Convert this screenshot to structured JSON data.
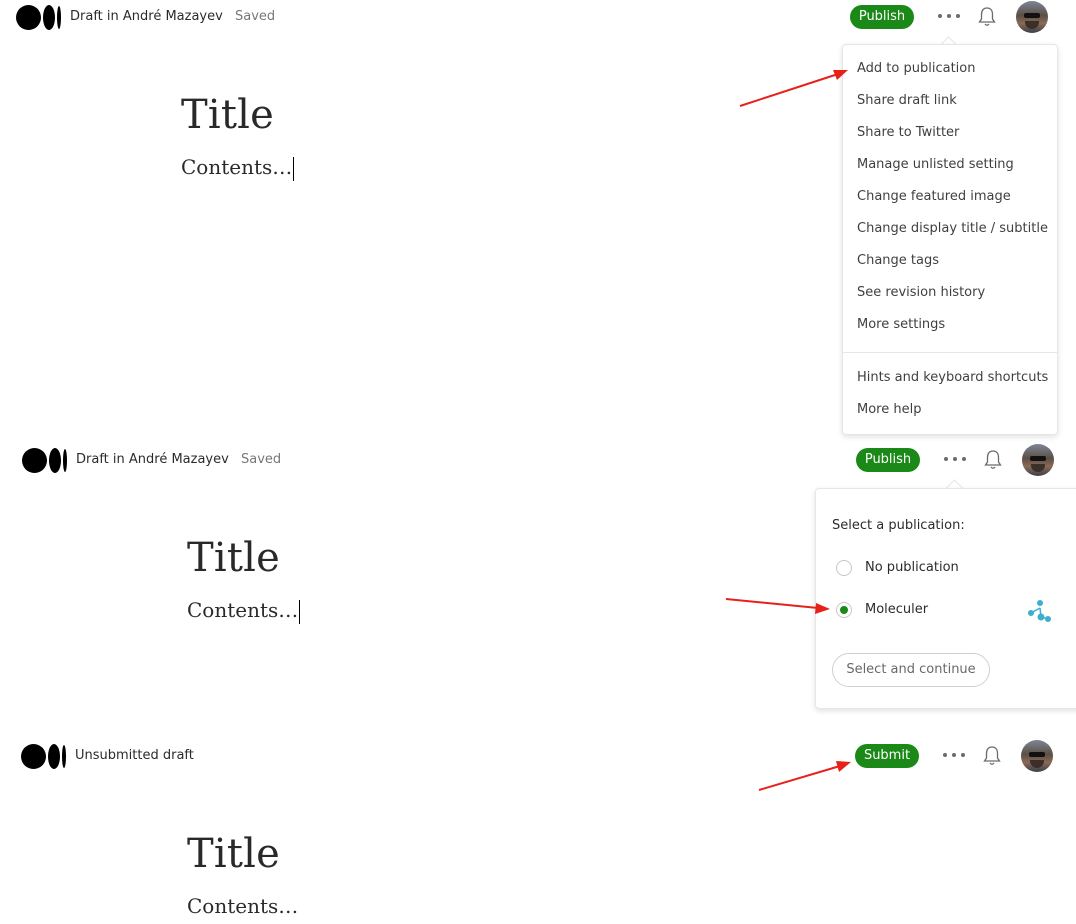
{
  "panel1": {
    "draft_label": "Draft in André Mazayev",
    "saved_label": "Saved",
    "publish_label": "Publish",
    "title": "Title",
    "contents": "Contents…"
  },
  "menu": {
    "items": [
      "Add to publication",
      "Share draft link",
      "Share to Twitter",
      "Manage unlisted setting",
      "Change featured image",
      "Change display title / subtitle",
      "Change tags",
      "See revision history",
      "More settings"
    ],
    "help_items": [
      "Hints and keyboard shortcuts",
      "More help"
    ]
  },
  "panel2": {
    "draft_label": "Draft in André Mazayev",
    "saved_label": "Saved",
    "publish_label": "Publish",
    "title": "Title",
    "contents": "Contents…",
    "publication_picker": {
      "heading": "Select a publication:",
      "options": [
        {
          "label": "No publication",
          "selected": false
        },
        {
          "label": "Moleculer",
          "selected": true
        }
      ],
      "continue_label": "Select and continue"
    }
  },
  "panel3": {
    "draft_label": "Unsubmitted draft",
    "submit_label": "Submit",
    "title": "Title",
    "contents": "Contents…"
  },
  "colors": {
    "accent_green": "#1a8917",
    "annotation_red": "#e8201a",
    "moleculer_blue": "#3cafce"
  },
  "icons": [
    "medium-logo-icon",
    "more-dots-icon",
    "bell-icon",
    "user-avatar",
    "moleculer-logo-icon",
    "annotation-arrow"
  ]
}
